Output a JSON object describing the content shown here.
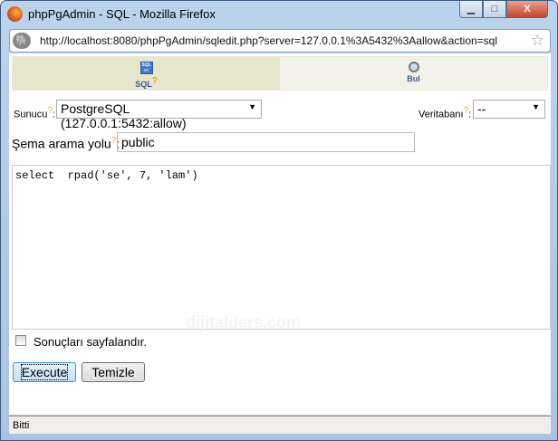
{
  "window": {
    "title": "phpPgAdmin - SQL - Mozilla Firefox",
    "minimize": "▁",
    "maximize": "□",
    "close": "X"
  },
  "address_bar": {
    "url": "http://localhost:8080/phpPgAdmin/sqledit.php?server=127.0.0.1%3A5432%3Aallow&action=sql"
  },
  "tabs": [
    {
      "label": "SQL",
      "help": "?",
      "icon": "sql-icon",
      "active": true
    },
    {
      "label": "Bul",
      "icon": "magnifier-icon",
      "active": false
    }
  ],
  "form": {
    "server_label": "Sunucu",
    "server_help": "?",
    "server_value": "PostgreSQL (127.0.0.1:5432:allow)",
    "database_label": "Veritabanı",
    "database_help": "?",
    "database_value": "--",
    "schema_label": "Şema arama yolu",
    "schema_help": "?",
    "schema_value": "public",
    "query": "select  rpad('se', 7, 'lam')",
    "paginate_label": "Sonuçları sayfalandır.",
    "paginate_checked": false,
    "execute_label": "Execute",
    "clear_label": "Temizle"
  },
  "watermark": "dijitalders.com",
  "status": "Bitti"
}
